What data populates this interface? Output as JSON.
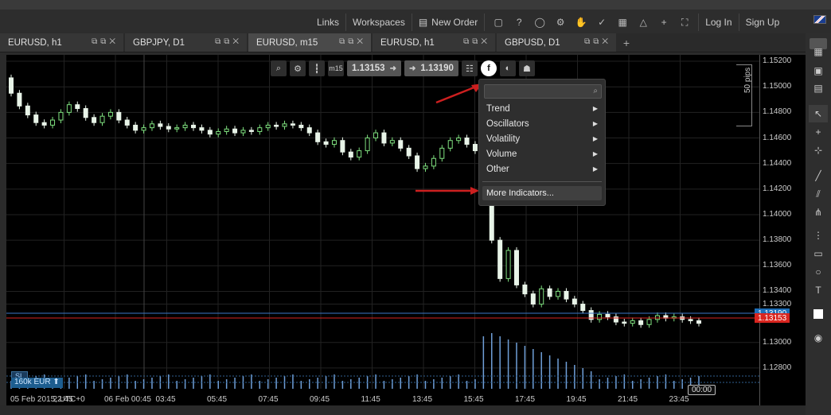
{
  "topnav": {
    "links": "Links",
    "workspaces": "Workspaces",
    "new_order": "New Order",
    "login": "Log In",
    "signup": "Sign Up"
  },
  "tabs": [
    {
      "label": "EURUSD, h1",
      "active": false
    },
    {
      "label": "GBPJPY, D1",
      "active": false
    },
    {
      "label": "EURUSD, m15",
      "active": true
    },
    {
      "label": "EURUSD, h1",
      "active": false
    },
    {
      "label": "GBPUSD, D1",
      "active": false
    }
  ],
  "chart_toolbar": {
    "timeframe": "m15",
    "bid_price": "1.13153",
    "ask_price": "1.13190",
    "indicator_button": "f"
  },
  "indicator_menu": {
    "items": [
      "Trend",
      "Oscillators",
      "Volatility",
      "Volume",
      "Other"
    ],
    "more": "More Indicators..."
  },
  "price_axis": {
    "labels": [
      "1.15200",
      "1.15000",
      "1.14800",
      "1.14600",
      "1.14400",
      "1.14200",
      "1.14000",
      "1.13800",
      "1.13600",
      "1.13400",
      "1.13300",
      "1.13000",
      "1.12800"
    ],
    "pips_label": "50 pips",
    "ask_badge": "1.13190",
    "bid_badge": "1.13153"
  },
  "time_axis": {
    "labels": [
      "05 Feb 2015, UTC+0",
      "22:45",
      "06 Feb 00:45",
      "03:45",
      "05:45",
      "07:45",
      "09:45",
      "11:45",
      "13:45",
      "15:45",
      "17:45",
      "19:45",
      "21:45",
      "23:45"
    ],
    "cursor_time": "00:00"
  },
  "bottom_left": {
    "sl": "SL",
    "volume": "160k EUR ⬆"
  },
  "colors": {
    "bull": "#7fe07f",
    "bear": "#e8f4e8",
    "volume": "#6f9fd8",
    "ask_line": "#3b77c8",
    "bid_line": "#d9251f",
    "arrow": "#cc1f1f"
  },
  "chart_data": {
    "type": "candlestick",
    "symbol": "EURUSD",
    "timeframe": "m15",
    "ylim": [
      1.127,
      1.1525
    ],
    "closes": [
      1.1495,
      1.1485,
      1.1478,
      1.1472,
      1.147,
      1.1474,
      1.148,
      1.1486,
      1.1483,
      1.1476,
      1.1472,
      1.1477,
      1.148,
      1.1474,
      1.147,
      1.1466,
      1.1468,
      1.1471,
      1.1469,
      1.1467,
      1.1468,
      1.147,
      1.1468,
      1.1466,
      1.1463,
      1.1465,
      1.1467,
      1.1464,
      1.1466,
      1.1465,
      1.1468,
      1.147,
      1.1469,
      1.1471,
      1.147,
      1.1468,
      1.1464,
      1.1457,
      1.1455,
      1.1458,
      1.1449,
      1.1445,
      1.145,
      1.146,
      1.1464,
      1.1456,
      1.1458,
      1.1452,
      1.1446,
      1.1436,
      1.1438,
      1.1444,
      1.1452,
      1.1458,
      1.146,
      1.1455,
      1.145,
      1.142,
      1.138,
      1.135,
      1.1372,
      1.1345,
      1.1338,
      1.133,
      1.1342,
      1.1336,
      1.134,
      1.1334,
      1.133,
      1.1325,
      1.1318,
      1.1322,
      1.132,
      1.1316,
      1.1315,
      1.1317,
      1.1314,
      1.1318,
      1.1321,
      1.1319,
      1.132,
      1.1318,
      1.1317,
      1.1315
    ],
    "volume_visible": true
  }
}
